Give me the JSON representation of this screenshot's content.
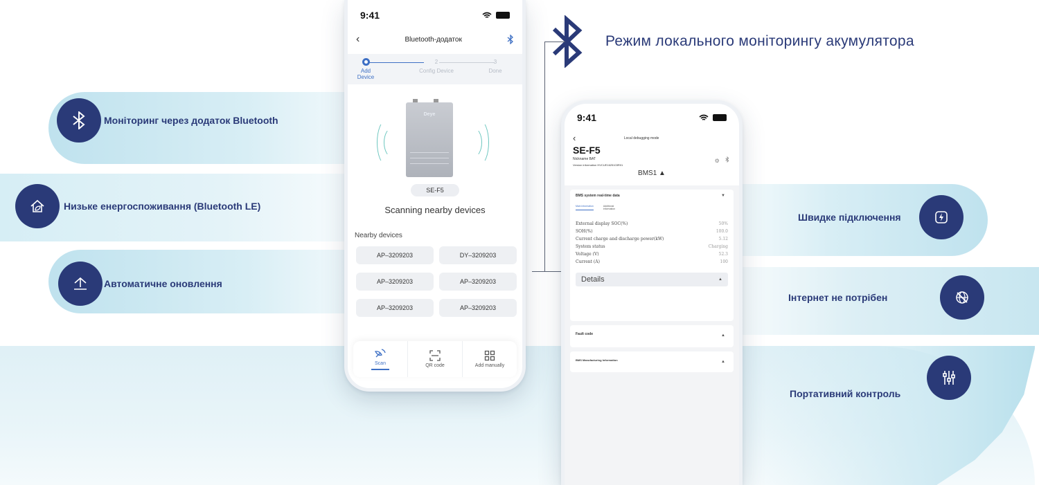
{
  "title": "Режим локального моніторингу акумулятора",
  "features_left": [
    {
      "label": "Моніторинг через додаток Bluetooth",
      "icon": "bluetooth-icon"
    },
    {
      "label": "Низьке енергоспоживання (Bluetooth LE)",
      "icon": "house-leaf-icon"
    },
    {
      "label": "Автоматичне оновлення",
      "icon": "upload-arrow-icon"
    }
  ],
  "features_right": [
    {
      "label": "Швидке підключення",
      "icon": "lightning-icon"
    },
    {
      "label": "Інтернет не потрібен",
      "icon": "no-globe-icon"
    },
    {
      "label": "Портативний контроль",
      "icon": "sliders-icon"
    }
  ],
  "phone1": {
    "time": "9:41",
    "nav_title": "Bluetooth-додаток",
    "steps": [
      {
        "num": "",
        "label": "Add Device"
      },
      {
        "num": "2",
        "label": "Config Device"
      },
      {
        "num": "3",
        "label": "Done"
      }
    ],
    "device_brand": "Deye",
    "device_name": "SE-F5",
    "scanning_text": "Scanning nearby devices",
    "nearby_title": "Nearby devices",
    "devices": [
      "AP–3209203",
      "DY–3209203",
      "AP–3209203",
      "AP–3209203",
      "AP–3209203",
      "AP–3209203"
    ],
    "tabs": [
      {
        "label": "Scan",
        "icon": "satellite-dish-icon"
      },
      {
        "label": "QR code",
        "icon": "qr-scan-icon"
      },
      {
        "label": "Add manually",
        "icon": "grid-icon"
      }
    ]
  },
  "phone2": {
    "time": "9:41",
    "nav_title": "Local debugging mode",
    "device_name": "SE-F5",
    "nickname": "Nickname BAT",
    "version": "Version information HVCUE1625103R01",
    "bms_selector": "BMS1 ▲",
    "realtime_title": "BMS system real-time data",
    "tab_main": "Main information",
    "tab_additional": "Additional information",
    "rows": [
      {
        "label": "External display SOC(%)",
        "value": "50%"
      },
      {
        "label": "SOH(%)",
        "value": "100.0"
      },
      {
        "label": "Current charge and discharge power(kW)",
        "value": "5.12"
      },
      {
        "label": "System status",
        "value": "Charging"
      },
      {
        "label": "Voltage (V)",
        "value": "52.3"
      },
      {
        "label": "Current (A)",
        "value": "100"
      }
    ],
    "details_label": "Details",
    "fault_code": "Fault code",
    "manufacturing": "BMS Manufacturing Information"
  }
}
